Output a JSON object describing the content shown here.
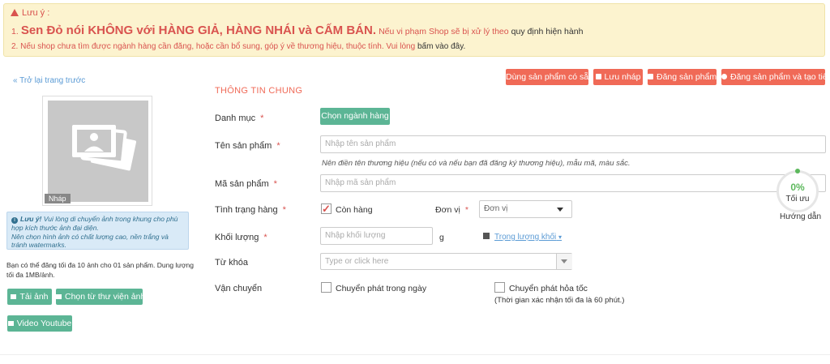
{
  "notice": {
    "title": "Lưu ý :",
    "line1_num": "1.",
    "line1_big": "Sen Đỏ nói KHÔNG với HÀNG GIẢ, HÀNG NHÁI và CẤM BÁN.",
    "line1_red": "Nếu vi phạm Shop sẽ bị xử lý theo",
    "line1_dark": "quy định hiện hành",
    "line2_red": "2. Nếu shop chưa tìm được ngành hàng cần đăng, hoặc cần bổ sung, góp ý về thương hiệu, thuộc tính. Vui lòng",
    "line2_dark": "bấm vào đây."
  },
  "back_link": "« Trở lại trang trước",
  "toolbar": {
    "use_existing": "Dùng sản phẩm có sẵn",
    "save_draft": "Lưu nháp",
    "post": "Đăng sản phẩm",
    "post_and_next": "Đăng sản phẩm và tạo tiếp"
  },
  "section_title": "THÔNG TIN CHUNG",
  "image": {
    "draft_badge": "Nháp"
  },
  "tip": {
    "bold": "Lưu ý!",
    "text1": "Vui lòng di chuyển ảnh trong khung cho phù hợp kích thước ảnh đại diện.",
    "text2": "Nên chọn hình ảnh có chất lượng cao, nền trắng và tránh watermarks."
  },
  "upload_limit": "Bạn có thể đăng tối đa 10 ảnh cho 01 sản phẩm. Dung lượng tối đa 1MB/ảnh.",
  "upload_buttons": {
    "upload": "Tải ảnh",
    "library": "Chọn từ thư viện ảnh",
    "youtube": "Video Youtube"
  },
  "form": {
    "category": {
      "label": "Danh mục",
      "button": "Chọn ngành hàng"
    },
    "name": {
      "label": "Tên sản phẩm",
      "placeholder": "Nhập tên sản phẩm",
      "hint": "Nên điền tên thương hiệu (nếu có và nếu bạn đã đăng ký thương hiệu), mẫu mã, màu sắc."
    },
    "sku": {
      "label": "Mã sản phẩm",
      "placeholder": "Nhập mã sản phẩm"
    },
    "stock": {
      "label": "Tình trạng hàng",
      "checkbox": "Còn hàng",
      "checked": true
    },
    "unit": {
      "label": "Đơn vị",
      "value": "Đơn vị"
    },
    "weight": {
      "label": "Khối lượng",
      "placeholder": "Nhập khối lượng",
      "unit": "g",
      "link": "Trọng lượng khối"
    },
    "keywords": {
      "label": "Từ khóa",
      "placeholder": "Type or click here"
    },
    "shipping": {
      "label": "Vận chuyển",
      "opt1": "Chuyển phát trong ngày",
      "opt2": "Chuyển phát hỏa tốc",
      "note": "(Thời gian xác nhận tối đa là 60 phút.)"
    }
  },
  "score": {
    "percent": "0%",
    "label": "Tối ưu",
    "guide": "Hướng dẫn"
  }
}
